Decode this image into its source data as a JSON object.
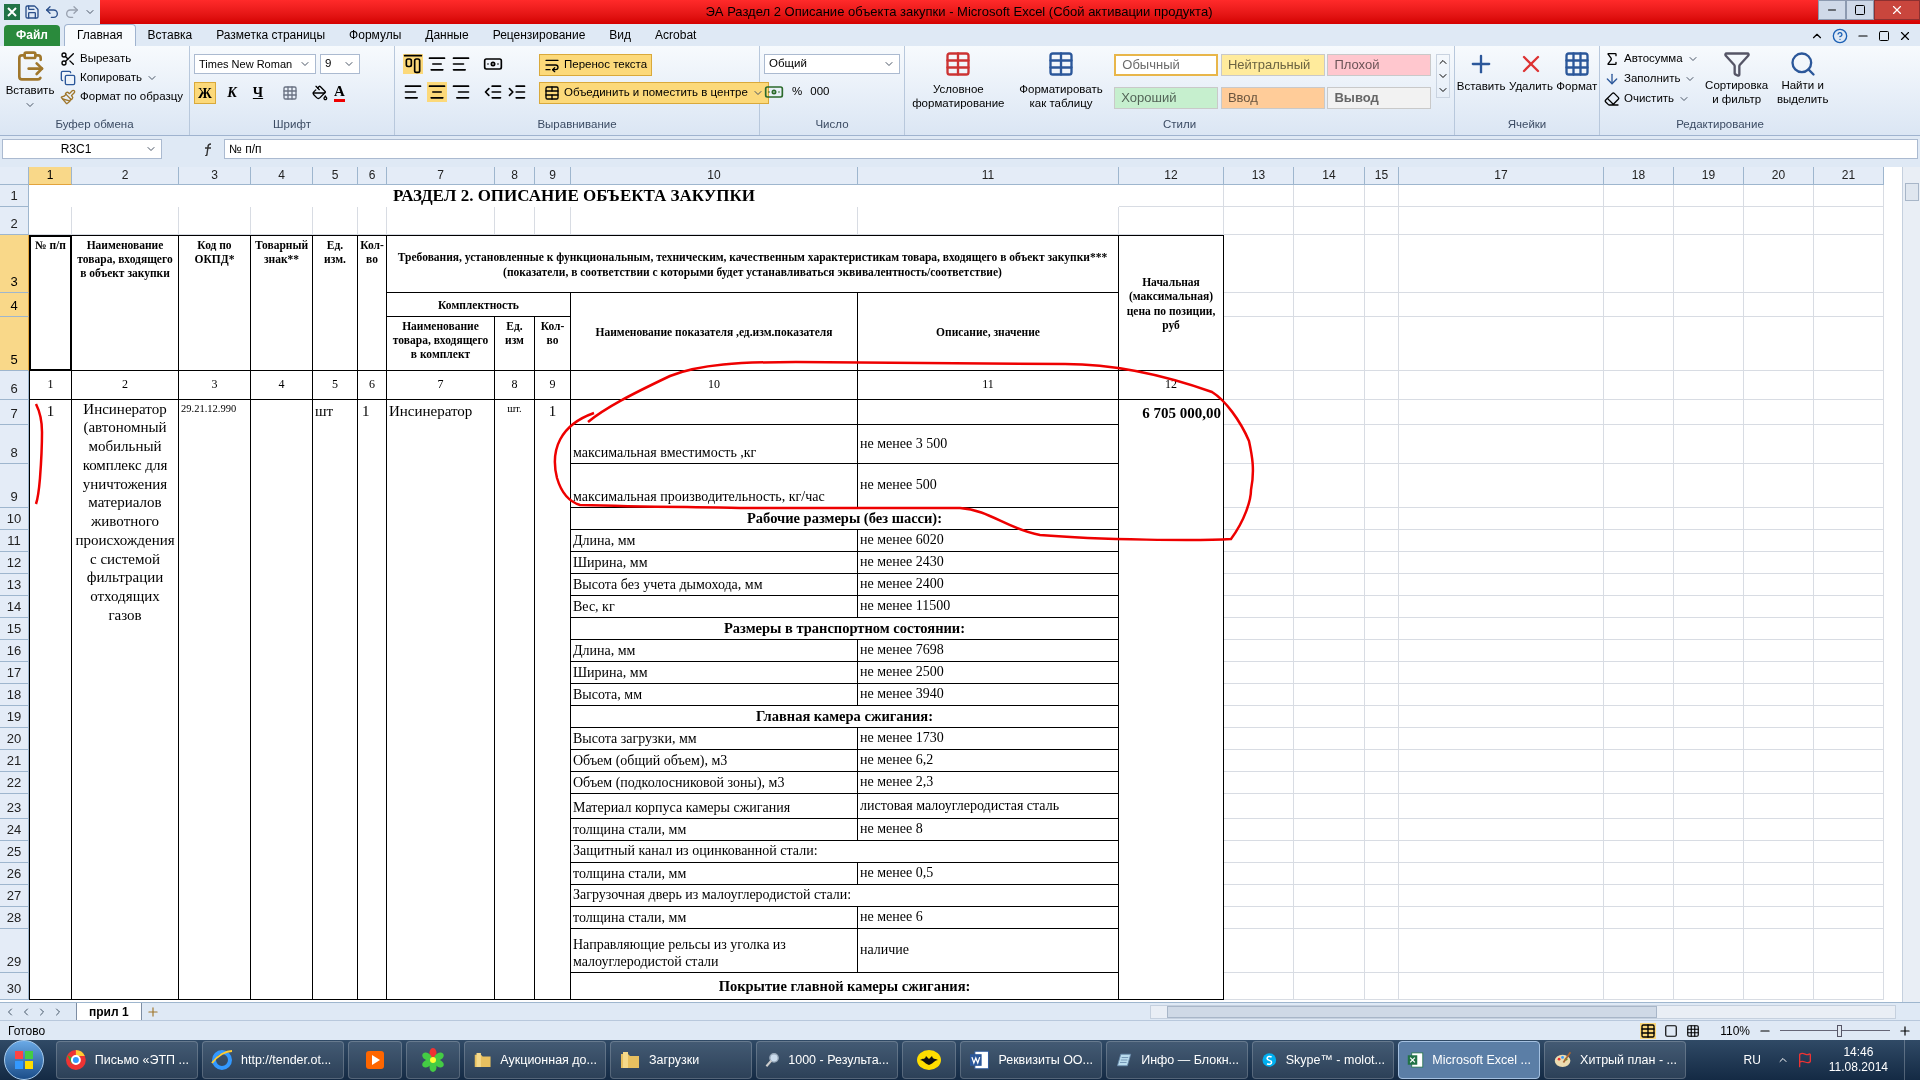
{
  "window": {
    "title": "ЭА Раздел 2 Описание объекта закупки - Microsoft Excel (Сбой активации продукта)"
  },
  "ribbon_tabs": [
    {
      "label": "Файл",
      "kind": "file",
      "selected": false
    },
    {
      "label": "Главная",
      "kind": "tab",
      "selected": true
    },
    {
      "label": "Вставка",
      "kind": "tab",
      "selected": false
    },
    {
      "label": "Разметка страницы",
      "kind": "tab",
      "selected": false
    },
    {
      "label": "Формулы",
      "kind": "tab",
      "selected": false
    },
    {
      "label": "Данные",
      "kind": "tab",
      "selected": false
    },
    {
      "label": "Рецензирование",
      "kind": "tab",
      "selected": false
    },
    {
      "label": "Вид",
      "kind": "tab",
      "selected": false
    },
    {
      "label": "Acrobat",
      "kind": "tab",
      "selected": false
    }
  ],
  "clipboard": {
    "group": "Буфер обмена",
    "paste": "Вставить",
    "cut": "Вырезать",
    "copy": "Копировать",
    "format_painter": "Формат по образцу"
  },
  "font": {
    "group": "Шрифт",
    "font_name": "Times New Roman",
    "font_size": "9",
    "bold": "Ж",
    "italic": "К",
    "underline": "Ч",
    "font_color": "А"
  },
  "alignment": {
    "group": "Выравнивание",
    "wrap_text": "Перенос текста",
    "merge": "Объединить и поместить в центре"
  },
  "number": {
    "group": "Число",
    "format": "Общий",
    "percent": "%",
    "thousands": "000"
  },
  "styles": {
    "group": "Стили",
    "conditional": "Условное форматирование",
    "as_table": "Форматировать как таблицу",
    "items": [
      {
        "label": "Обычный",
        "color": "#ffffff",
        "selected": true
      },
      {
        "label": "Нейтральный",
        "color": "#ffeb9c",
        "selected": false
      },
      {
        "label": "Плохой",
        "color": "#ffc7ce",
        "selected": false
      },
      {
        "label": "Хороший",
        "color": "#c6efce",
        "selected": false
      },
      {
        "label": "Ввод",
        "color": "#ffcc99",
        "selected": false
      },
      {
        "label": "Вывод",
        "color": "#f2f2f2",
        "selected": false
      }
    ]
  },
  "cells": {
    "group": "Ячейки",
    "insert": "Вставить",
    "delete": "Удалить",
    "format": "Формат"
  },
  "editing": {
    "group": "Редактирование",
    "autosum": "Автосумма",
    "fill": "Заполнить",
    "clear": "Очистить",
    "sort": "Сортировка и фильтр",
    "find": "Найти и выделить"
  },
  "formula_bar": {
    "name_box": "R3C1",
    "formula": "№ п/п"
  },
  "column_headers": [
    {
      "label": "1",
      "selected": true
    },
    {
      "label": "2",
      "selected": false
    },
    {
      "label": "3",
      "selected": false
    },
    {
      "label": "4",
      "selected": false
    },
    {
      "label": "5",
      "selected": false
    },
    {
      "label": "6",
      "selected": false
    },
    {
      "label": "7",
      "selected": false
    },
    {
      "label": "8",
      "selected": false
    },
    {
      "label": "9",
      "selected": false
    },
    {
      "label": "10",
      "selected": false
    },
    {
      "label": "11",
      "selected": false
    },
    {
      "label": "12",
      "selected": false
    },
    {
      "label": "13",
      "selected": false
    },
    {
      "label": "14",
      "selected": false
    },
    {
      "label": "15",
      "selected": false
    },
    {
      "label": "17",
      "selected": false
    },
    {
      "label": "18",
      "selected": false
    },
    {
      "label": "19",
      "selected": false
    },
    {
      "label": "20",
      "selected": false
    },
    {
      "label": "21",
      "selected": false
    }
  ],
  "row_headers": [
    {
      "label": "1",
      "selected": false
    },
    {
      "label": "2",
      "selected": false
    },
    {
      "label": "3",
      "selected": true
    },
    {
      "label": "4",
      "selected": true
    },
    {
      "label": "5",
      "selected": true
    },
    {
      "label": "6",
      "selected": false
    },
    {
      "label": "7",
      "selected": false
    },
    {
      "label": "8",
      "selected": false
    },
    {
      "label": "9",
      "selected": false
    },
    {
      "label": "10",
      "selected": false
    },
    {
      "label": "11",
      "selected": false
    },
    {
      "label": "12",
      "selected": false
    },
    {
      "label": "13",
      "selected": false
    },
    {
      "label": "14",
      "selected": false
    },
    {
      "label": "15",
      "selected": false
    },
    {
      "label": "16",
      "selected": false
    },
    {
      "label": "17",
      "selected": false
    },
    {
      "label": "18",
      "selected": false
    },
    {
      "label": "19",
      "selected": false
    },
    {
      "label": "20",
      "selected": false
    },
    {
      "label": "21",
      "selected": false
    },
    {
      "label": "22",
      "selected": false
    },
    {
      "label": "23",
      "selected": false
    },
    {
      "label": "24",
      "selected": false
    },
    {
      "label": "25",
      "selected": false
    },
    {
      "label": "26",
      "selected": false
    },
    {
      "label": "27",
      "selected": false
    },
    {
      "label": "28",
      "selected": false
    },
    {
      "label": "29",
      "selected": false
    },
    {
      "label": "30",
      "selected": false
    }
  ],
  "sheet": {
    "title": "РАЗДЕЛ 2. ОПИСАНИЕ ОБЪЕКТА ЗАКУПКИ",
    "header": [
      "№ п/п",
      "Наименование товара, входящего в объект закупки",
      "Код по ОКПД*",
      "Товарный знак**",
      "Ед. изм.",
      "Кол-во",
      "Требования, установленные к функциональным, техническим, качественным характеристикам товара, входящего в объект закупки*** (показатели, в соответствии с которыми будет устанавливаться эквивалентность/соответствие)",
      "Комплектность",
      "Наименование товара, входящего в комплект",
      "Ед. изм",
      "Кол-во",
      "Наименование  показателя ,ед.изм.показателя",
      "Описание, значение",
      "Начальная (максимальная) цена по позиции, руб"
    ],
    "numbering": [
      "1",
      "2",
      "3",
      "4",
      "5",
      "6",
      "7",
      "8",
      "9",
      "10",
      "11",
      "12"
    ],
    "item": {
      "number": "1",
      "name": "Инсинератор (автономный мобильный комплекс для уничтожения материалов животного происхождения с системой фильтрации отходящих газов",
      "okpd": "29.21.12.990",
      "unit": "шт",
      "qty": "1",
      "component": "Инсинератор",
      "component_unit": "шт.",
      "component_qty": "1",
      "price": "6 705 000,00"
    },
    "specs": [
      {
        "kind": "blank"
      },
      {
        "kind": "pair",
        "name": "максимальная вместимость ,кг",
        "value": "не менее 3 500"
      },
      {
        "kind": "pair",
        "name": "максимальная производительность, кг/час",
        "value": "не менее 500"
      },
      {
        "kind": "section",
        "text": "Рабочие размеры (без шасси):"
      },
      {
        "kind": "pair",
        "name": "Длина, мм",
        "value": "не менее 6020"
      },
      {
        "kind": "pair",
        "name": "Ширина, мм",
        "value": "не менее 2430"
      },
      {
        "kind": "pair",
        "name": "Высота без учета дымохода, мм",
        "value": "не менее 2400"
      },
      {
        "kind": "pair",
        "name": "Вес, кг",
        "value": "не менее 11500"
      },
      {
        "kind": "section",
        "text": "Размеры в транспортном состоянии:"
      },
      {
        "kind": "pair",
        "name": "Длина, мм",
        "value": "не менее 7698"
      },
      {
        "kind": "pair",
        "name": "Ширина, мм",
        "value": "не менее 2500"
      },
      {
        "kind": "pair",
        "name": "Высота, мм",
        "value": "не менее 3940"
      },
      {
        "kind": "section",
        "text": "Главная камера сжигания:"
      },
      {
        "kind": "pair",
        "name": "Высота загрузки, мм",
        "value": "не менее 1730"
      },
      {
        "kind": "pair",
        "name": "Объем (общий объем),  м3",
        "value": "не менее 6,2"
      },
      {
        "kind": "pair",
        "name": "Объем (подколосниковой зоны), м3",
        "value": "не менее 2,3"
      },
      {
        "kind": "pair",
        "name": "Материал корпуса камеры сжигания",
        "value": "листовая малоуглеродистая сталь"
      },
      {
        "kind": "pair",
        "name": "толщина стали, мм",
        "value": "не менее 8"
      },
      {
        "kind": "note",
        "text": "Защитный канал из оцинкованной стали:"
      },
      {
        "kind": "pair",
        "name": "толщина стали, мм",
        "value": "не менее 0,5"
      },
      {
        "kind": "note",
        "text": "Загрузочная дверь из малоуглеродистой стали:"
      },
      {
        "kind": "pair",
        "name": "толщина стали, мм",
        "value": "не менее 6"
      },
      {
        "kind": "pair",
        "name": "Направляющие рельсы из уголка из малоуглеродистой стали",
        "value": "наличие"
      },
      {
        "kind": "section",
        "text": "Покрытие главной камеры сжигания:"
      }
    ]
  },
  "sheet_tabs": [
    {
      "label": "прил 1",
      "selected": true
    }
  ],
  "status_bar": {
    "status": "Готово",
    "zoom": "110%",
    "zoom_slider": {
      "level": 0.52
    }
  },
  "taskbar": {
    "items": [
      {
        "kind": "browser",
        "label": "Письмо «ЭТП ...",
        "selected": false
      },
      {
        "kind": "web",
        "label": "http://tender.ot...",
        "selected": false
      },
      {
        "kind": "media",
        "selected": false
      },
      {
        "kind": "flower",
        "selected": false
      },
      {
        "kind": "folder",
        "label": "Аукционная до...",
        "selected": false
      },
      {
        "kind": "folder",
        "label": "Загрузки",
        "selected": false
      },
      {
        "kind": "search",
        "label": "1000 - Результа...",
        "selected": false
      },
      {
        "kind": "emblem",
        "selected": false
      },
      {
        "kind": "document",
        "label": "Реквизиты ОО...",
        "selected": false
      },
      {
        "kind": "notepad",
        "label": "Инфо — Блокн...",
        "selected": false
      },
      {
        "kind": "chat",
        "label": "Skype™ - molot...",
        "selected": false
      },
      {
        "kind": "spreadsheet",
        "label": "Microsoft Excel ...",
        "selected": true
      },
      {
        "kind": "paint",
        "label": "Хитрый план - ...",
        "selected": false
      }
    ],
    "language": "RU",
    "time": "14:46",
    "date": "11.08.2014"
  }
}
